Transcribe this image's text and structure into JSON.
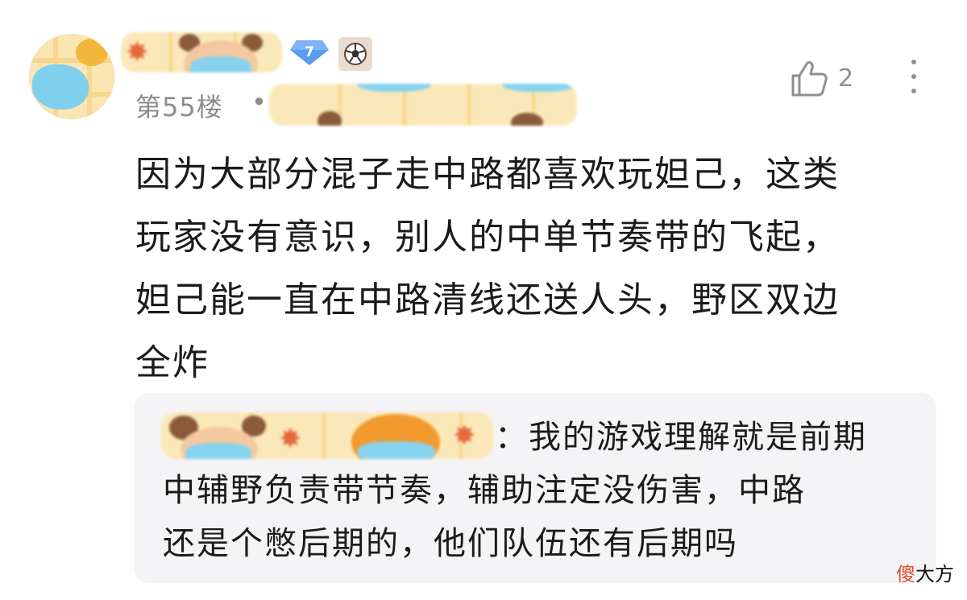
{
  "post": {
    "level_badge": "7",
    "floor": "第55楼",
    "separator": "•",
    "like_count": "2",
    "comment_lines": [
      "因为大部分混子走中路都喜欢玩妲己，这类",
      "玩家没有意识，别人的中单节奏带的飞起，",
      "妲己能一直在中路清线还送人头，野区双边",
      "全炸"
    ]
  },
  "reply": {
    "colon": "：",
    "lines": [
      "我的游戏理解就是前期",
      "中辅野负责带节奏，辅助注定没伤害，中路",
      "还是个憋后期的，他们队伍还有后期吗"
    ]
  },
  "watermark": {
    "first_char": "傻",
    "rest": "大方"
  },
  "icons": {
    "avatar": "avatar-blurred",
    "level": "diamond-level-icon",
    "badge": "soccer-ball-icon",
    "like": "thumbs-up-icon",
    "more": "more-vertical-icon"
  },
  "colors": {
    "level_badge": "#5b9bf0",
    "meta_text": "#8c8c8c",
    "reply_bg": "#f4f4f6",
    "watermark_accent": "#e24a2a"
  }
}
